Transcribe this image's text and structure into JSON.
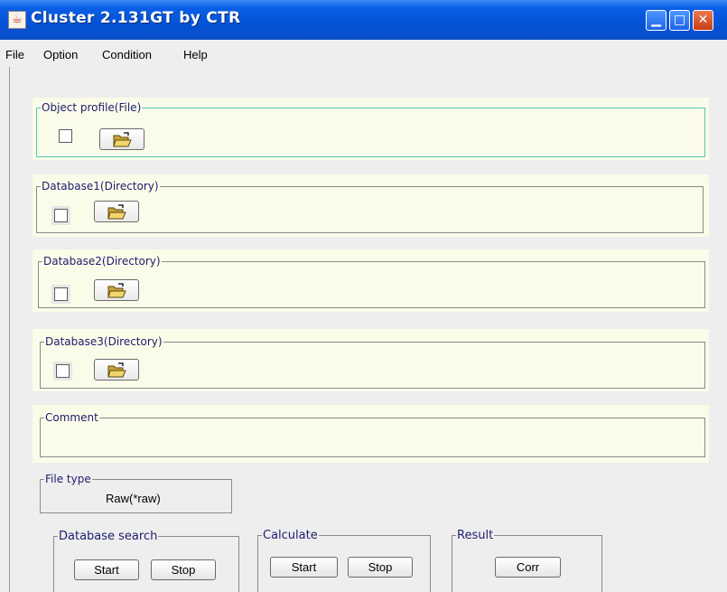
{
  "window": {
    "title": "Cluster 2.131GT by CTR",
    "controls": [
      "minimize",
      "maximize",
      "close"
    ]
  },
  "menu": [
    "File",
    "Option",
    "Condition",
    "Help"
  ],
  "sections": {
    "object_profile": {
      "legend": "Object profile(File)"
    },
    "database1": {
      "legend": "Database1(Directory)"
    },
    "database2": {
      "legend": "Database2(Directory)"
    },
    "database3": {
      "legend": "Database3(Directory)"
    },
    "comment": {
      "legend": "Comment",
      "value": ""
    }
  },
  "file_type": {
    "legend": "File type",
    "value": "Raw(*raw)"
  },
  "database_search": {
    "legend": "Database search",
    "start": "Start",
    "stop": "Stop"
  },
  "calculate": {
    "legend": "Calculate",
    "start": "Start",
    "stop": "Stop"
  },
  "result": {
    "legend": "Result",
    "corr": "Corr"
  },
  "colors": {
    "titlebar": "#0552d6",
    "panel_bg": "#fbfbe9",
    "teal_border": "#59c7b3"
  }
}
